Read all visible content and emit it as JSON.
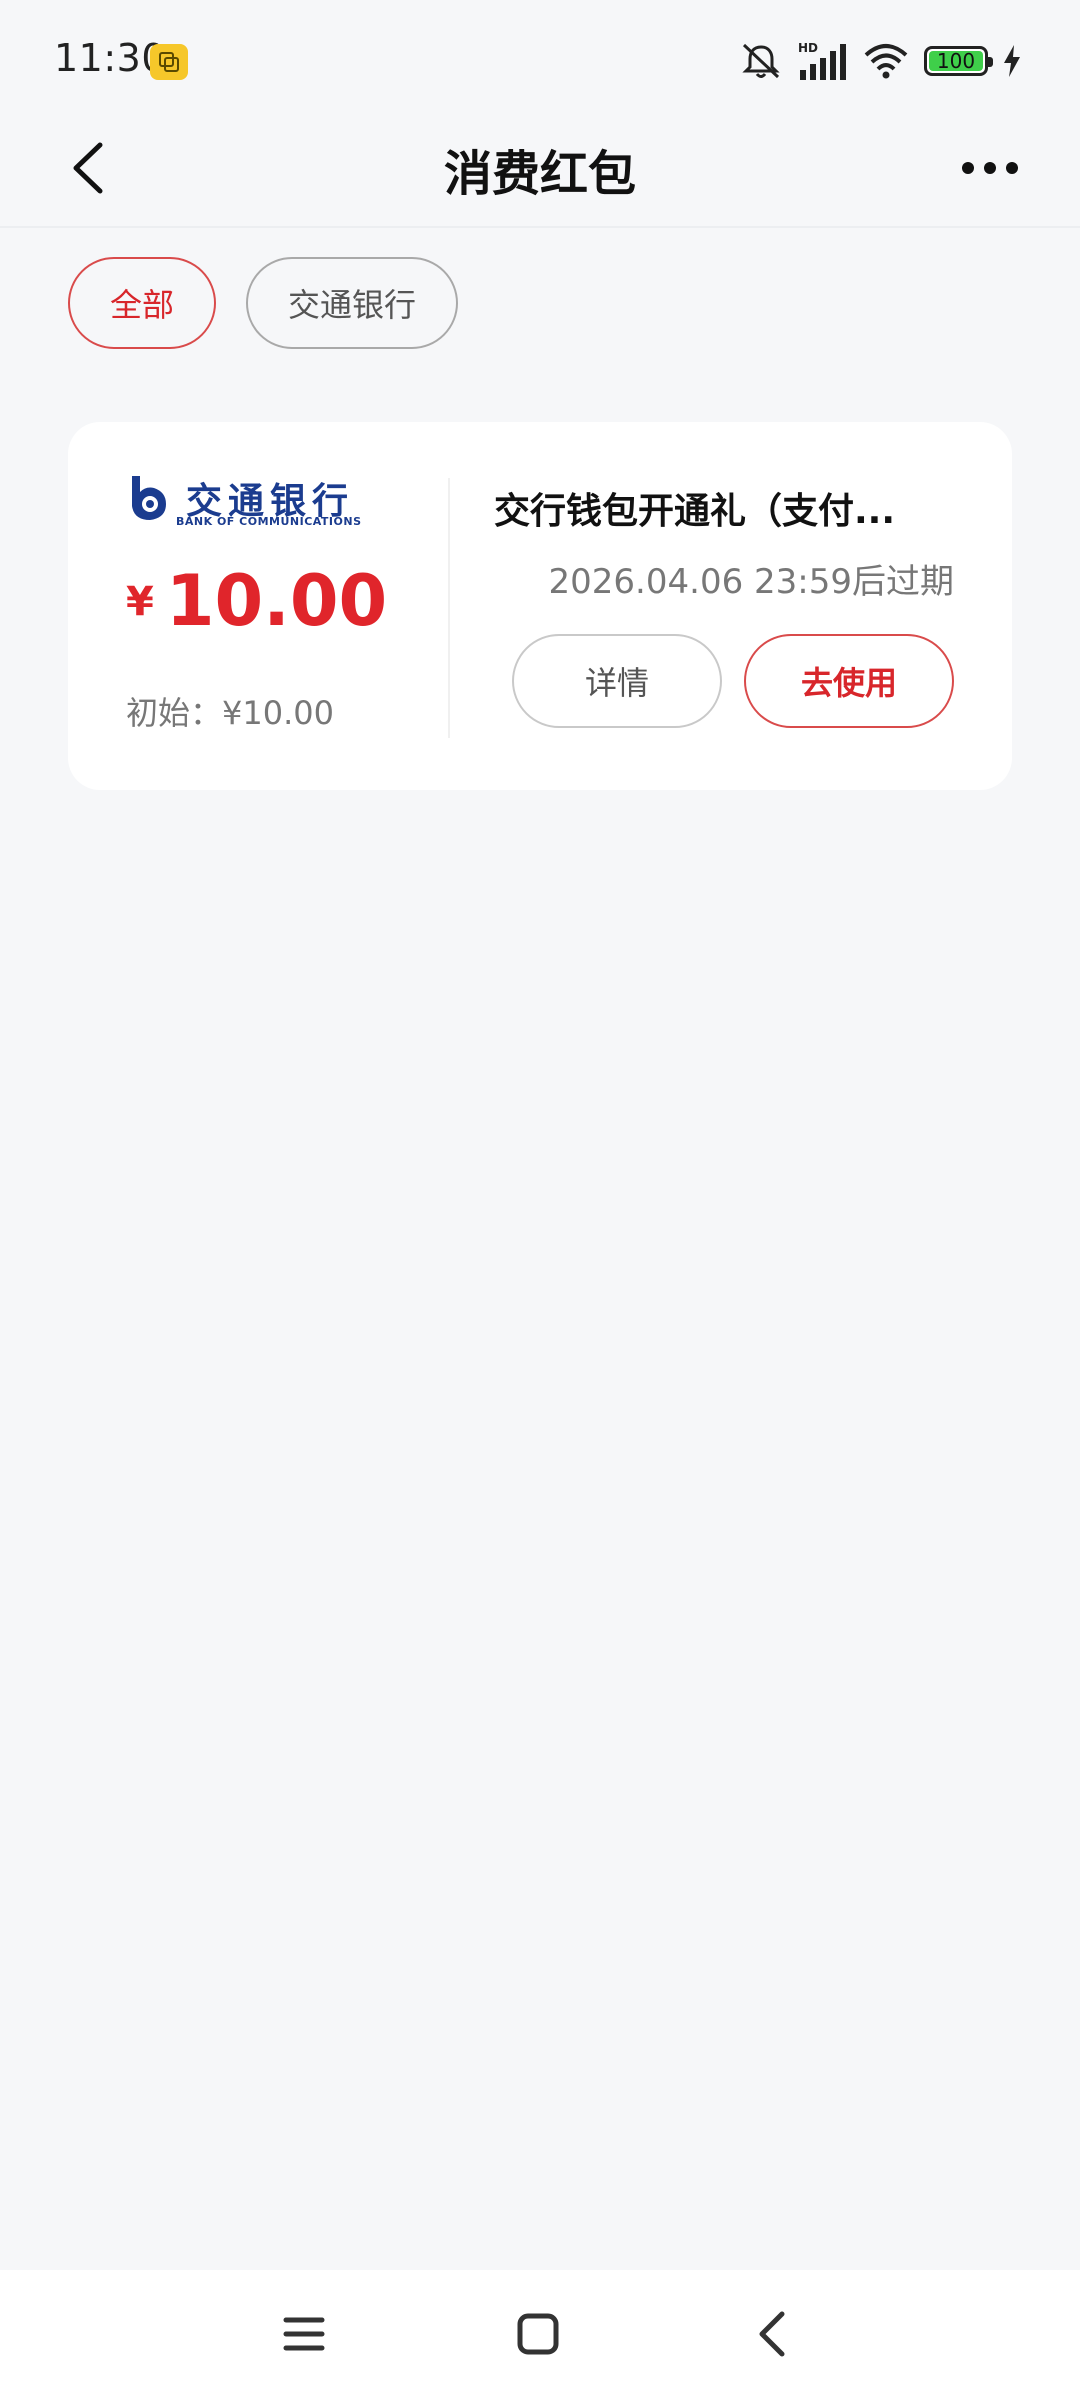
{
  "status_bar": {
    "time": "11:30",
    "battery": "100",
    "icons": [
      "app-notification-icon",
      "mute-icon",
      "hd-signal-icon",
      "wifi-icon",
      "battery-icon",
      "charging-icon"
    ]
  },
  "header": {
    "title": "消费红包",
    "back_icon": "chevron-left-icon",
    "more_icon": "more-dots-icon"
  },
  "filters": [
    {
      "label": "全部",
      "active": true
    },
    {
      "label": "交通银行",
      "active": false
    }
  ],
  "coupon": {
    "bank_logo": {
      "name_cn": "交通银行",
      "name_en": "BANK OF COMMUNICATIONS"
    },
    "currency": "¥",
    "amount": "10.00",
    "initial_amount": "初始：¥10.00",
    "title": "交行钱包开通礼（支付...",
    "expiry": "2026.04.06 23:59后过期",
    "detail_label": "详情",
    "use_label": "去使用"
  },
  "colors": {
    "accent": "#d8262b",
    "background": "#f6f7f9",
    "bank_blue": "#1b3c8f"
  },
  "nav_bar": {
    "icons": [
      "menu-icon",
      "home-icon",
      "back-icon"
    ]
  }
}
